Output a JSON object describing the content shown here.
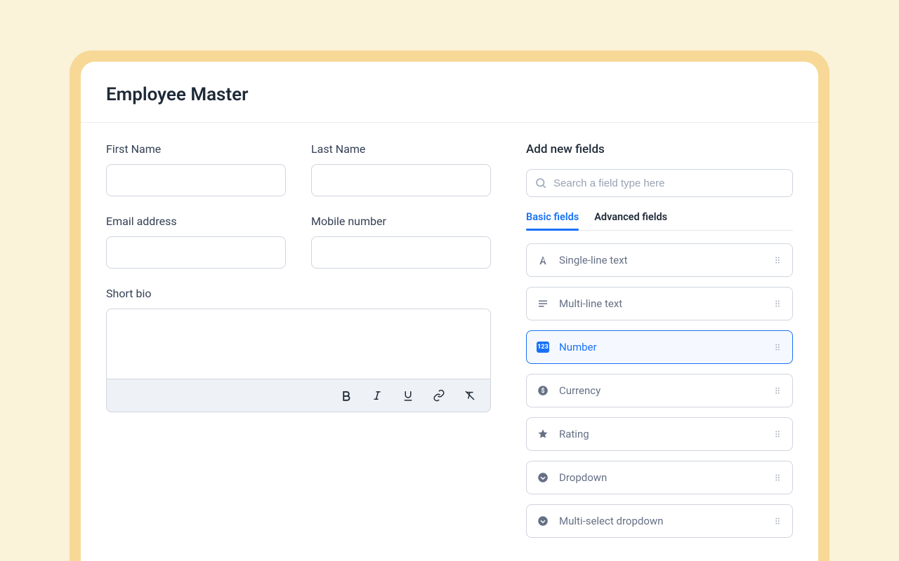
{
  "header": {
    "title": "Employee Master"
  },
  "form": {
    "first_name": {
      "label": "First Name",
      "value": ""
    },
    "last_name": {
      "label": "Last Name",
      "value": ""
    },
    "email": {
      "label": "Email address",
      "value": ""
    },
    "mobile": {
      "label": "Mobile number",
      "value": ""
    },
    "bio": {
      "label": "Short bio",
      "value": ""
    }
  },
  "rte": {
    "bold": "Bold",
    "italic": "Italic",
    "underline": "Underline",
    "link": "Link",
    "clear": "Clear formatting"
  },
  "panel": {
    "title": "Add new fields",
    "search_placeholder": "Search a field type here",
    "tabs": {
      "basic": "Basic fields",
      "advanced": "Advanced fields",
      "active": "basic"
    },
    "items": [
      {
        "icon": "text-a",
        "label": "Single-line text",
        "active": false
      },
      {
        "icon": "lines",
        "label": "Multi-line text",
        "active": false
      },
      {
        "icon": "123",
        "label": "Number",
        "active": true
      },
      {
        "icon": "currency",
        "label": "Currency",
        "active": false
      },
      {
        "icon": "star",
        "label": "Rating",
        "active": false
      },
      {
        "icon": "chevcirc",
        "label": "Dropdown",
        "active": false
      },
      {
        "icon": "chevcirc",
        "label": "Multi-select dropdown",
        "active": false
      }
    ]
  }
}
